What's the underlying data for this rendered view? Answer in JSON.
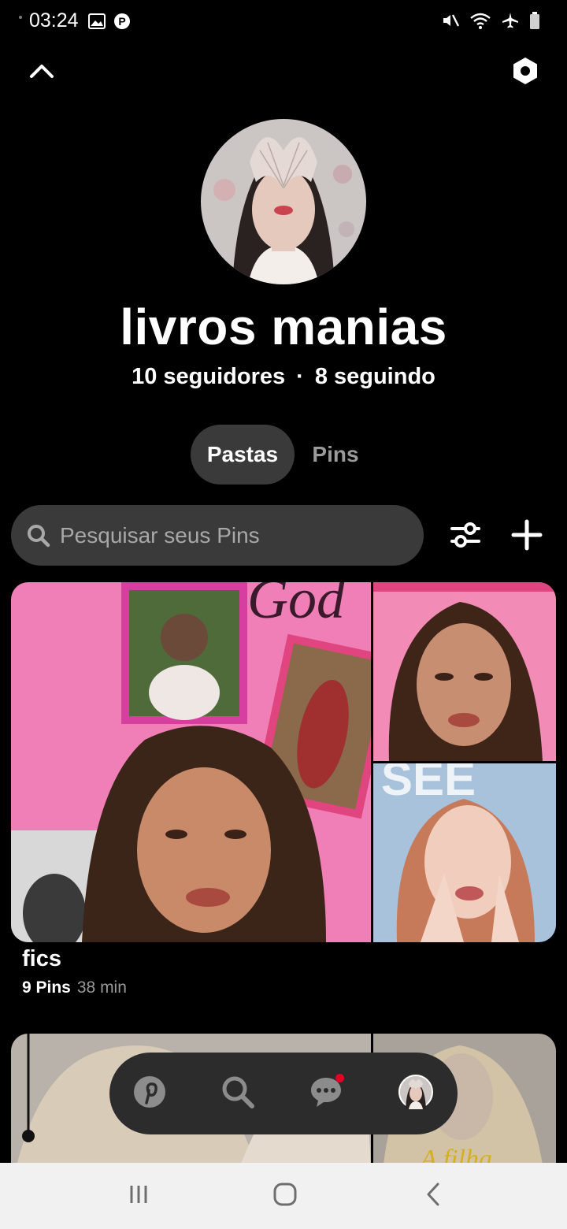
{
  "status_bar": {
    "time": "03:24",
    "left_icons": [
      "image-icon",
      "pinterest-icon"
    ],
    "right_icons": [
      "mute-icon",
      "wifi-icon",
      "airplane-icon",
      "battery-icon"
    ]
  },
  "header": {
    "collapse_icon": "chevron-up-icon",
    "settings_icon": "settings-hex-icon"
  },
  "profile": {
    "name": "livros manias",
    "followers": "10 seguidores",
    "separator": "·",
    "following": "8 seguindo"
  },
  "tabs": [
    {
      "label": "Pastas",
      "active": true
    },
    {
      "label": "Pins",
      "active": false
    }
  ],
  "search": {
    "placeholder": "Pesquisar seus Pins",
    "value": ""
  },
  "toolbar": {
    "filter_icon": "filter-sliders-icon",
    "add_icon": "plus-icon"
  },
  "boards": [
    {
      "title": "fics",
      "pins": "9 Pins",
      "updated": "38 min"
    },
    {
      "title": "",
      "pins": "",
      "updated": ""
    }
  ],
  "bottom_nav": {
    "items": [
      "pinterest-home-icon",
      "search-icon",
      "messages-icon",
      "profile-avatar"
    ],
    "notification_on": "messages-icon"
  },
  "colors": {
    "background": "#000000",
    "pill": "#3a3a3a",
    "nav": "#2c2c2c",
    "muted_text": "#9a9a9a",
    "notification": "#e60023"
  }
}
